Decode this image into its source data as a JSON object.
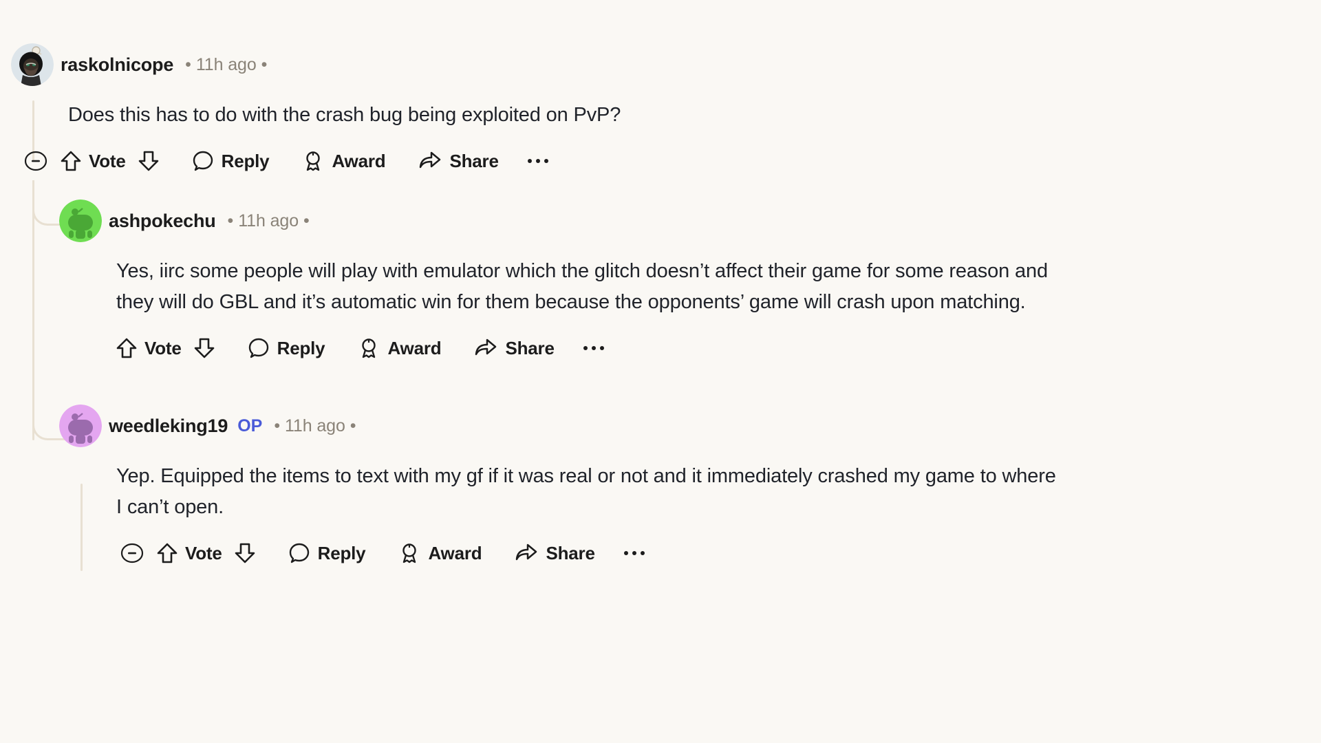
{
  "theme": {
    "background": "#faf8f4",
    "text": "#20232a",
    "meta_text": "#8a8378",
    "op_badge_color": "#4a5bd8",
    "thread_line": "#e8e0d2"
  },
  "actions": {
    "vote_label": "Vote",
    "reply_label": "Reply",
    "award_label": "Award",
    "share_label": "Share",
    "more_label": "",
    "upvote_icon": "upvote-arrow-icon",
    "downvote_icon": "downvote-arrow-icon",
    "reply_icon": "comment-bubble-icon",
    "award_icon": "award-medal-icon",
    "share_icon": "share-arrow-icon",
    "more_icon": "more-options-icon",
    "collapse_icon": "collapse-minus-icon"
  },
  "comments": [
    {
      "id": "c1",
      "author": "raskolnicope",
      "op": false,
      "op_label": "",
      "timestamp": "11h ago",
      "separator": "•",
      "body": "Does this has to do with the crash bug being exploited on PvP?",
      "avatar": {
        "name": "avatar-raskolnicope",
        "background": "#dde5ea",
        "body_color": "#1a1a1a",
        "accent_color": "#efe9dc",
        "face_color": "#6b5b4a"
      },
      "has_collapse": true
    },
    {
      "id": "c2",
      "author": "ashpokechu",
      "op": false,
      "op_label": "",
      "timestamp": "11h ago",
      "separator": "•",
      "body": "Yes, iirc some people will play with emulator which the glitch doesn’t affect their game for some reason and they will do GBL and it’s automatic win for them because the opponents’ game will crash upon matching.",
      "avatar": {
        "name": "avatar-ashpokechu",
        "background": "#6fdd52",
        "body_color": "#4aa836",
        "accent_color": "#4aa836",
        "face_color": "#4aa836"
      },
      "has_collapse": false
    },
    {
      "id": "c3",
      "author": "weedleking19",
      "op": true,
      "op_label": "OP",
      "timestamp": "11h ago",
      "separator": "•",
      "body": "Yep. Equipped the items to text with my gf if it was real or not and it immediately crashed my game to where I can’t open.",
      "avatar": {
        "name": "avatar-weedleking19",
        "background": "#e4a6f0",
        "body_color": "#9b6bad",
        "accent_color": "#9b6bad",
        "face_color": "#9b6bad"
      },
      "has_collapse": true
    }
  ]
}
